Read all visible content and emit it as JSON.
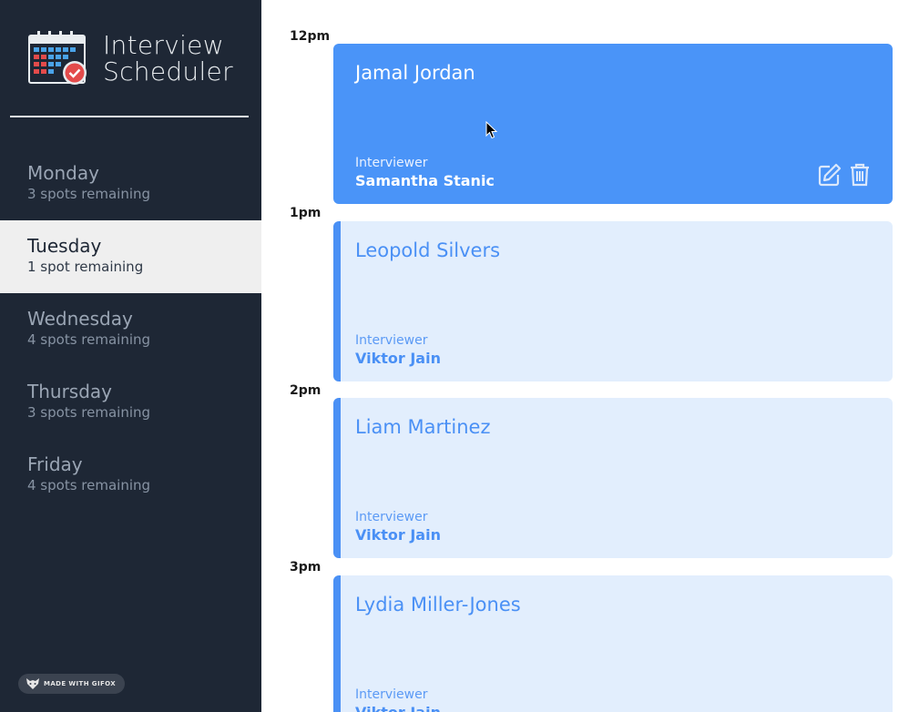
{
  "brand": {
    "title_line1": "Interview",
    "title_line2": "Scheduler"
  },
  "days": [
    {
      "name": "Monday",
      "spots": "3 spots remaining",
      "selected": false
    },
    {
      "name": "Tuesday",
      "spots": "1 spot remaining",
      "selected": true
    },
    {
      "name": "Wednesday",
      "spots": "4 spots remaining",
      "selected": false
    },
    {
      "name": "Thursday",
      "spots": "3 spots remaining",
      "selected": false
    },
    {
      "name": "Friday",
      "spots": "4 spots remaining",
      "selected": false
    }
  ],
  "badge": {
    "text": "MADE WITH GIFOX"
  },
  "times": [
    "12pm",
    "1pm",
    "2pm",
    "3pm"
  ],
  "appointments": [
    {
      "student": "Jamal Jordan",
      "interviewer_label": "Interviewer",
      "interviewer": "Samantha Stanic",
      "active": true
    },
    {
      "student": "Leopold Silvers",
      "interviewer_label": "Interviewer",
      "interviewer": "Viktor Jain",
      "active": false
    },
    {
      "student": "Liam Martinez",
      "interviewer_label": "Interviewer",
      "interviewer": "Viktor Jain",
      "active": false
    },
    {
      "student": "Lydia Miller-Jones",
      "interviewer_label": "Interviewer",
      "interviewer": "Viktor Jain",
      "active": false
    }
  ],
  "icons": {
    "edit": "edit-icon",
    "delete": "trash-icon",
    "logo": "calendar-check-icon"
  },
  "colors": {
    "sidebar": "#1e2735",
    "accent": "#4a90f5",
    "card_bg": "#e2eefd",
    "selected_day": "#efefef"
  }
}
